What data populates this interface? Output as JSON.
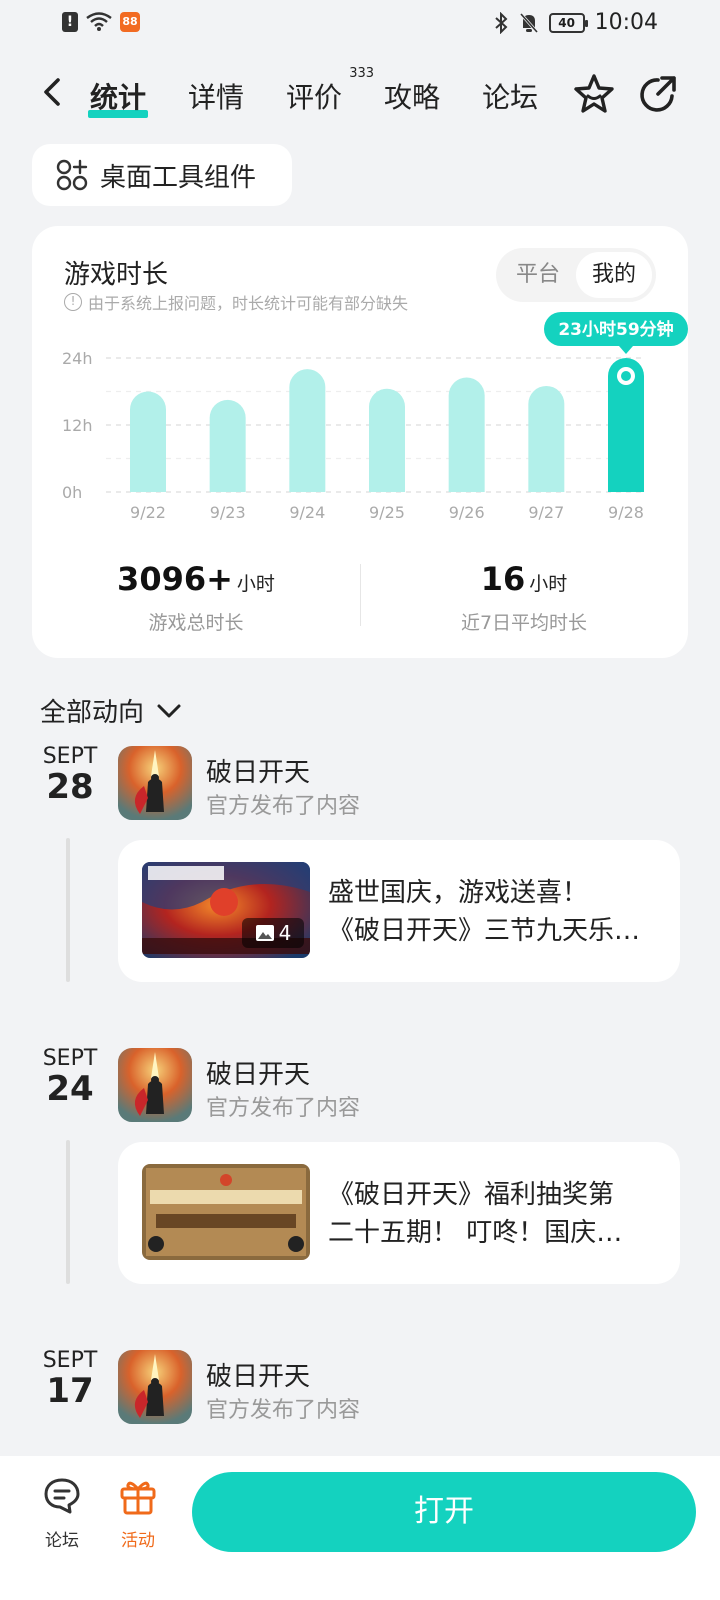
{
  "status_bar": {
    "time": "10:04",
    "battery": "40",
    "app_badge": "88"
  },
  "nav": {
    "tabs": [
      {
        "label": "统计"
      },
      {
        "label": "详情"
      },
      {
        "label": "评价",
        "badge": "333"
      },
      {
        "label": "攻略"
      },
      {
        "label": "论坛"
      }
    ],
    "active_tab": "统计",
    "icons": [
      "back-icon",
      "star-icon",
      "share-icon"
    ]
  },
  "widget_chip": {
    "label": "桌面工具组件",
    "icon": "widget-grid-icon"
  },
  "stats_card": {
    "title": "游戏时长",
    "note": "由于系统上报问题，时长统计可能有部分缺失",
    "toggle": {
      "options": [
        "平台",
        "我的"
      ],
      "selected": "我的"
    },
    "total": {
      "value": "3096+",
      "unit": "小时",
      "label": "游戏总时长"
    },
    "average": {
      "value": "16",
      "unit": "小时",
      "label": "近7日平均时长"
    }
  },
  "chart_data": {
    "type": "bar",
    "categories": [
      "9/22",
      "9/23",
      "9/24",
      "9/25",
      "9/26",
      "9/27",
      "9/28"
    ],
    "values": [
      18,
      16.5,
      22,
      18.5,
      20.5,
      19,
      24
    ],
    "ytick_labels": [
      "0h",
      "12h",
      "24h"
    ],
    "yticks": [
      0,
      12,
      24
    ],
    "ylim": [
      0,
      24
    ],
    "highlight_index": 6,
    "highlight_label": "23小时59分钟",
    "grid": true,
    "colors": {
      "bar": "#b2f0ea",
      "highlight": "#14d2bf"
    }
  },
  "feed": {
    "header": "全部动向",
    "items": [
      {
        "month": "SEPT",
        "day": "28",
        "app_name": "破日开天",
        "subtitle": "官方发布了内容",
        "post_line1": "盛世国庆，游戏送喜！",
        "post_line2": "《破日开天》三节九天乐…",
        "image_count": "4"
      },
      {
        "month": "SEPT",
        "day": "24",
        "app_name": "破日开天",
        "subtitle": "官方发布了内容",
        "post_line1": "《破日开天》福利抽奖第",
        "post_line2": "二十五期！ 叮咚！国庆…"
      },
      {
        "month": "SEPT",
        "day": "17",
        "app_name": "破日开天",
        "subtitle": "官方发布了内容"
      }
    ]
  },
  "bottom_bar": {
    "forum_label": "论坛",
    "activity_label": "活动",
    "open_label": "打开",
    "accent": "#14d2bf",
    "activity_color": "#f06a1a"
  }
}
